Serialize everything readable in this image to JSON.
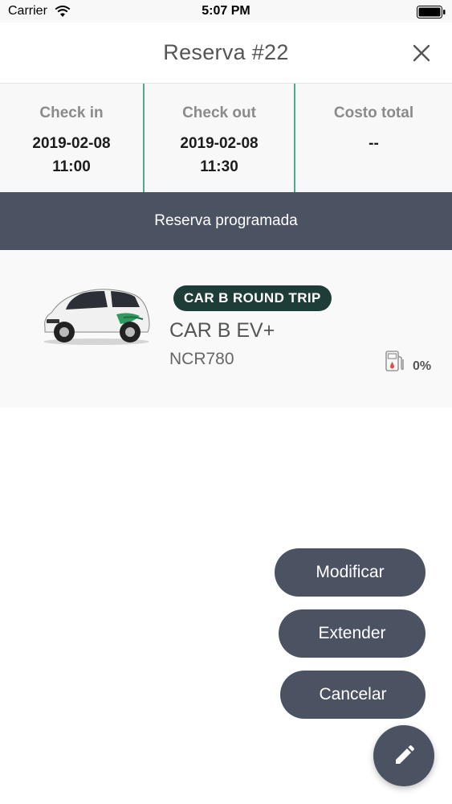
{
  "status_bar": {
    "carrier": "Carrier",
    "time": "5:07 PM"
  },
  "header": {
    "title": "Reserva #22",
    "close_icon": "close-icon"
  },
  "reservation": {
    "check_in": {
      "label": "Check in",
      "date": "2019-02-08",
      "time": "11:00"
    },
    "check_out": {
      "label": "Check out",
      "date": "2019-02-08",
      "time": "11:30"
    },
    "total_cost": {
      "label": "Costo total",
      "value": "--"
    }
  },
  "status": {
    "label": "Reserva programada"
  },
  "car": {
    "badge": "CAR B ROUND TRIP",
    "model": "CAR B EV+",
    "plate": "NCR780",
    "fuel_level": "0%",
    "fuel_icon": "fuel-pump-icon"
  },
  "actions": {
    "modify": "Modificar",
    "extend": "Extender",
    "cancel": "Cancelar",
    "edit_icon": "pencil-icon"
  },
  "colors": {
    "banner": "#4b5262",
    "divider": "#4fa98d",
    "badge": "#1f3d38"
  }
}
